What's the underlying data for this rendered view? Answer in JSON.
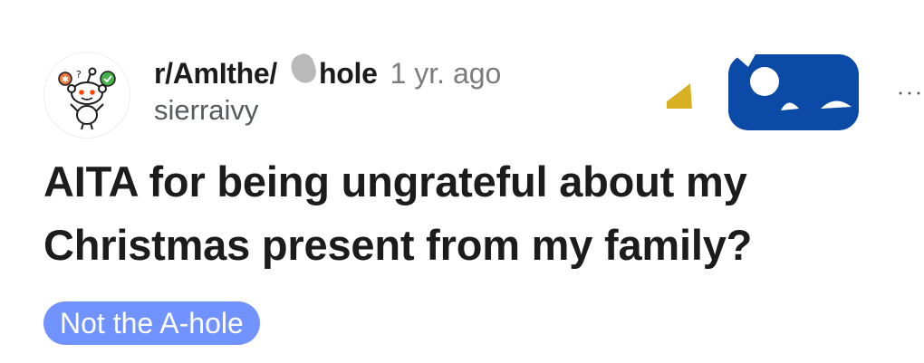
{
  "post": {
    "subreddit_prefix": "r/AmIthe/",
    "subreddit_suffix": "hole",
    "time_ago": "1 yr. ago",
    "author": "sierraivy",
    "title": "AITA for being ungrateful about my Christmas present from my family?",
    "flair": "Not the A-hole"
  },
  "icons": {
    "avatar": "snoo-avatar-icon",
    "award_gold": "gold-award-icon",
    "award_blue": "blue-award-icon",
    "more": "more-options-icon"
  },
  "colors": {
    "flair_bg": "#7193ff",
    "award_blue": "#0b4aa6",
    "award_gold": "#d8b023",
    "text_primary": "#1c1c1c",
    "text_muted": "#7c7c7c"
  }
}
